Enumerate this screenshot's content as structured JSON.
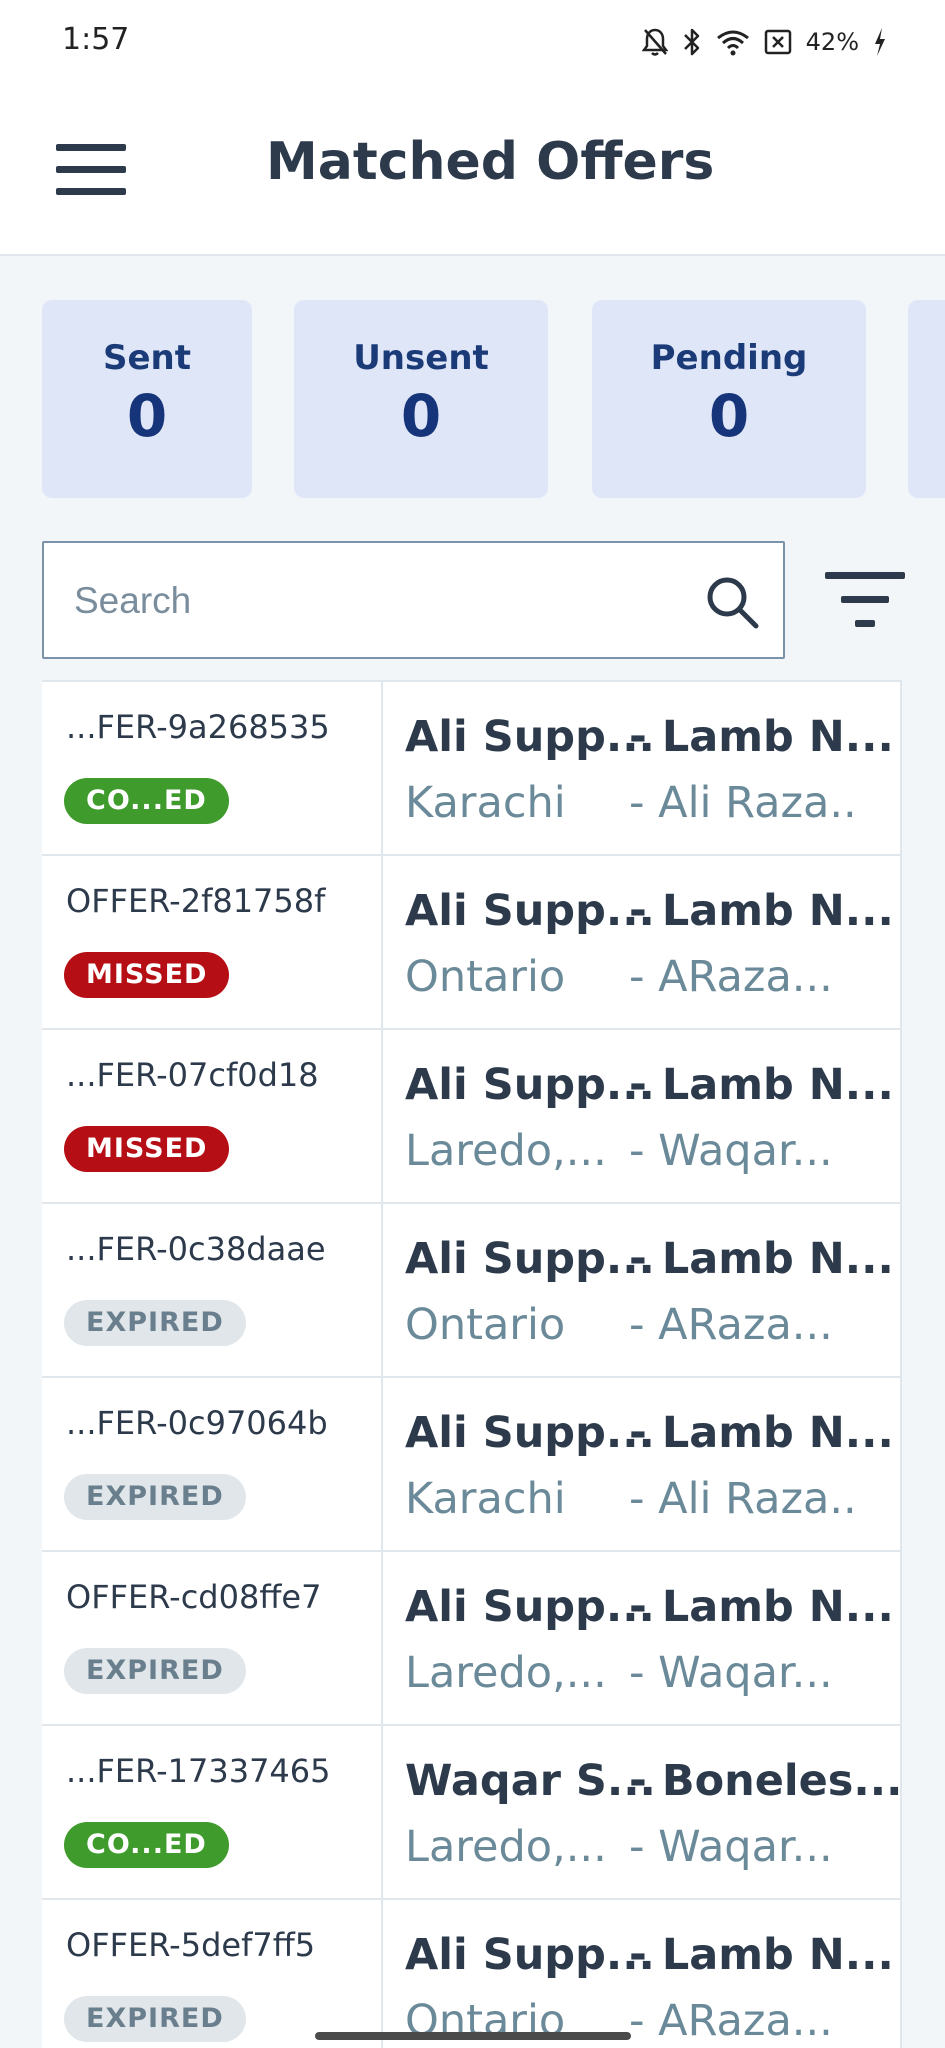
{
  "status_bar": {
    "time": "1:57",
    "battery": "42%"
  },
  "header": {
    "title": "Matched Offers"
  },
  "stats": [
    {
      "label": "Sent",
      "value": "0"
    },
    {
      "label": "Unsent",
      "value": "0"
    },
    {
      "label": "Pending",
      "value": "0"
    }
  ],
  "search": {
    "placeholder": "Search",
    "value": ""
  },
  "colors": {
    "card_bg": "#dfe6f7",
    "card_text": "#16347a",
    "completed": "#3e9b2c",
    "missed": "#b50f15",
    "expired": "#e0e6ea"
  },
  "offers": [
    {
      "id": "...FER-9a268535",
      "status": "CO...ED",
      "status_type": "completed",
      "supplier": "Ali Supp...",
      "product": "- Lamb N...",
      "location": "Karachi",
      "contact": "- Ali Raza.."
    },
    {
      "id": "OFFER-2f81758f",
      "status": "MISSED",
      "status_type": "missed",
      "supplier": "Ali Supp...",
      "product": "- Lamb N...",
      "location": "Ontario",
      "contact": "- ARaza..."
    },
    {
      "id": "...FER-07cf0d18",
      "status": "MISSED",
      "status_type": "missed",
      "supplier": "Ali Supp...",
      "product": "- Lamb N...",
      "location": "Laredo,...",
      "contact": "- Waqar..."
    },
    {
      "id": "...FER-0c38daae",
      "status": "EXPIRED",
      "status_type": "expired",
      "supplier": "Ali Supp...",
      "product": "- Lamb N...",
      "location": "Ontario",
      "contact": "- ARaza..."
    },
    {
      "id": "...FER-0c97064b",
      "status": "EXPIRED",
      "status_type": "expired",
      "supplier": "Ali Supp...",
      "product": "- Lamb N...",
      "location": "Karachi",
      "contact": "- Ali Raza.."
    },
    {
      "id": "OFFER-cd08ffe7",
      "status": "EXPIRED",
      "status_type": "expired",
      "supplier": "Ali Supp...",
      "product": "- Lamb N...",
      "location": "Laredo,...",
      "contact": "- Waqar..."
    },
    {
      "id": "...FER-17337465",
      "status": "CO...ED",
      "status_type": "completed",
      "supplier": "Waqar S...",
      "product": "- Boneles...",
      "location": "Laredo,...",
      "contact": "- Waqar..."
    },
    {
      "id": "OFFER-5def7ff5",
      "status": "EXPIRED",
      "status_type": "expired",
      "supplier": "Ali Supp...",
      "product": "- Lamb N...",
      "location": "Ontario",
      "contact": "- ARaza..."
    }
  ]
}
